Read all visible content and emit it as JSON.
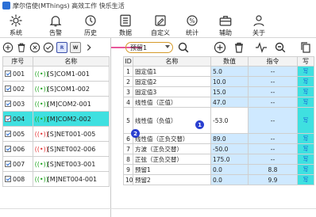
{
  "app": {
    "title": "摩尔信使(MThings) 高效工作 快乐生活"
  },
  "toolbar": {
    "items": [
      {
        "label": "系统",
        "icon": "gear-icon"
      },
      {
        "label": "告警",
        "icon": "bell-icon"
      },
      {
        "label": "历史",
        "icon": "history-icon"
      },
      {
        "label": "数据",
        "icon": "data-list-icon"
      },
      {
        "label": "自定义",
        "icon": "custom-edit-icon"
      },
      {
        "label": "统计",
        "icon": "statistics-icon"
      },
      {
        "label": "辅助",
        "icon": "toolbox-icon"
      },
      {
        "label": "关于",
        "icon": "user-info-icon"
      }
    ],
    "active": "数据"
  },
  "left_panel": {
    "buttons": [
      {
        "name": "add",
        "icon": "plus-circle-icon"
      },
      {
        "name": "delete",
        "icon": "trash-icon"
      },
      {
        "name": "cancel",
        "icon": "x-circle-icon"
      },
      {
        "name": "confirm",
        "icon": "check-circle-icon"
      },
      {
        "name": "read",
        "label": "R"
      },
      {
        "name": "write",
        "label": "W"
      },
      {
        "name": "more",
        "icon": "chevron-right-icon"
      }
    ],
    "columns": [
      "序号",
      "名称"
    ],
    "devices": [
      {
        "index": "001",
        "status": "ok",
        "name": "[S]COM1-001"
      },
      {
        "index": "002",
        "status": "ok",
        "name": "[S]COM1-002"
      },
      {
        "index": "003",
        "status": "ok",
        "name": "[M]COM2-001"
      },
      {
        "index": "004",
        "status": "ok",
        "name": "[M]COM2-002",
        "selected": true
      },
      {
        "index": "005",
        "status": "bad",
        "name": "[S]NET001-005"
      },
      {
        "index": "006",
        "status": "bad",
        "name": "[S]NET002-006"
      },
      {
        "index": "007",
        "status": "ok",
        "name": "[S]NET003-001"
      },
      {
        "index": "008",
        "status": "ok",
        "name": "[M]NET004-001"
      }
    ]
  },
  "right_panel": {
    "combo_value": "预留1",
    "columns": [
      "ID",
      "名称",
      "数值",
      "指令",
      "写"
    ],
    "rows": [
      {
        "id": "1",
        "name": "固定值1",
        "value": "5.0",
        "cmd": "--",
        "write": "写"
      },
      {
        "id": "2",
        "name": "固定值2",
        "value": "10.0",
        "cmd": "--",
        "write": "写"
      },
      {
        "id": "3",
        "name": "固定值3",
        "value": "15.0",
        "cmd": "--",
        "write": "写"
      },
      {
        "id": "4",
        "name": "线性值（正值）",
        "value": "47.0",
        "cmd": "--",
        "write": "写"
      },
      {
        "id": "5",
        "name": "线性值（负值）",
        "value": "-53.0",
        "cmd": "--",
        "write": "写"
      },
      {
        "id": "6",
        "name": "线性值（正负交替）",
        "value": "89.0",
        "cmd": "--",
        "write": "写"
      },
      {
        "id": "7",
        "name": "方波（正负交替）",
        "value": "-50.0",
        "cmd": "--",
        "write": "写"
      },
      {
        "id": "8",
        "name": "正弦（正负交替）",
        "value": "175.0",
        "cmd": "--",
        "write": "写"
      },
      {
        "id": "9",
        "name": "预留1",
        "value": "0.0",
        "cmd": "8.8",
        "write": "写"
      },
      {
        "id": "10",
        "name": "预留2",
        "value": "0.0",
        "cmd": "9.9",
        "write": "写"
      }
    ],
    "annotations": [
      "1",
      "2"
    ]
  }
}
